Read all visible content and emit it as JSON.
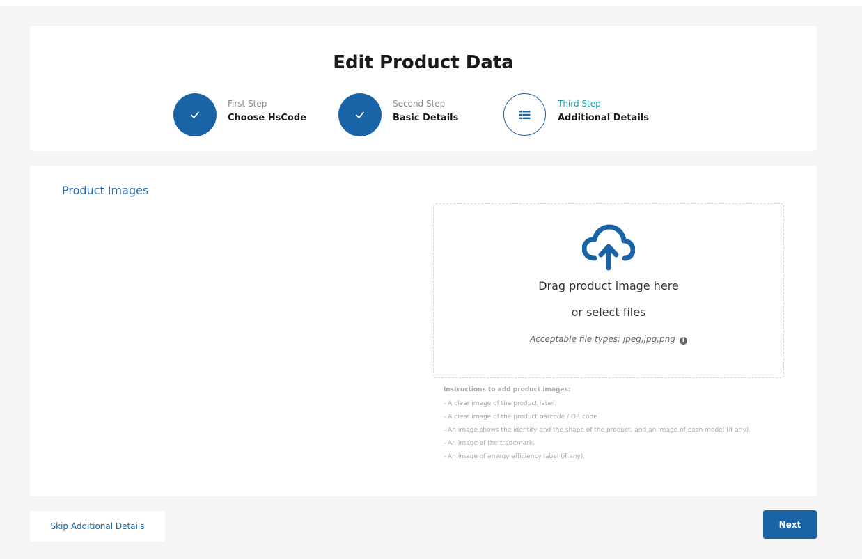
{
  "header": {
    "title": "Edit Product Data",
    "steps": [
      {
        "sub": "First Step",
        "label": "Choose HsCode",
        "state": "done",
        "icon": "check-icon"
      },
      {
        "sub": "Second Step",
        "label": "Basic Details",
        "state": "done",
        "icon": "check-icon"
      },
      {
        "sub": "Third Step",
        "label": "Additional Details",
        "state": "active",
        "icon": "list-icon"
      }
    ]
  },
  "main": {
    "section_title": "Product Images",
    "dropzone": {
      "line1": "Drag product image here",
      "line2": "or select files",
      "hint": "Acceptable file types: jpeg,jpg,png",
      "icon": "cloud-upload-icon"
    },
    "instructions": {
      "title": "Instructions to add product images:",
      "items": [
        "- A clear image of the product label.",
        "- A clear image of the product barcode / QR code.",
        "- An image shows the identity and the shape of the product, and an image of each model (if any).",
        "- An image of the trademark.",
        "- An image of energy efficiency label (if any)."
      ]
    }
  },
  "footer": {
    "skip_label": "Skip Additional Details",
    "next_label": "Next"
  },
  "colors": {
    "primary": "#1a63a6",
    "active_step_sub": "#1aa0a5",
    "section_title": "#2a6aa8"
  }
}
